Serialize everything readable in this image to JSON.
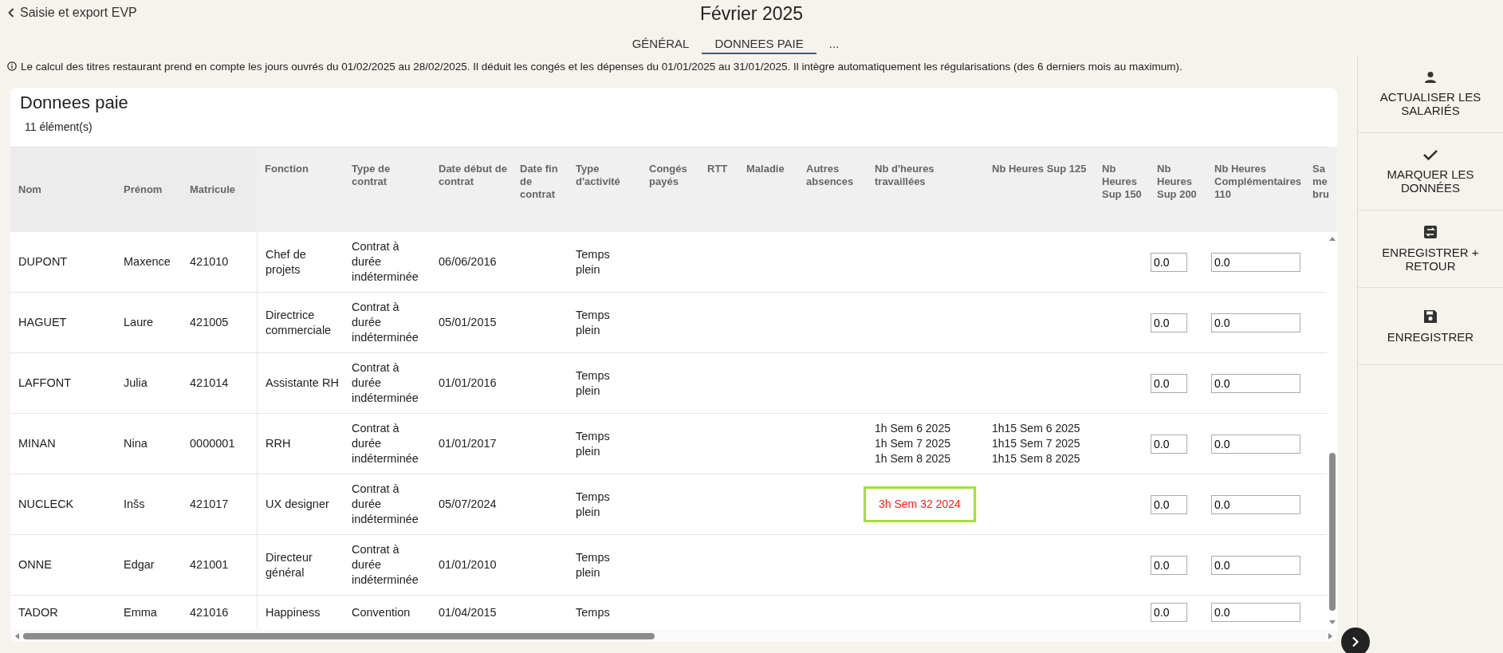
{
  "header": {
    "back_label": "Saisie et export EVP",
    "title": "Février 2025"
  },
  "tabs": [
    {
      "label": "GÉNÉRAL",
      "selected": false
    },
    {
      "label": "DONNEES PAIE",
      "selected": true
    },
    {
      "label": "...",
      "selected": false
    }
  ],
  "info": "Le calcul des titres restaurant prend en compte les jours ouvrés du 01/02/2025 au 28/02/2025. Il déduit les congés et les dépenses du 01/01/2025 au 31/01/2025. Il intègre automatiquement les régularisations (des 6 derniers mois au maximum).",
  "card": {
    "title": "Donnees paie",
    "count": "11 élément(s)"
  },
  "table": {
    "columns": [
      "Nom",
      "Prénom",
      "Matricule",
      "Fonction",
      "Type de contrat",
      "Date début de contrat",
      "Date fin de contrat",
      "Type d'activité",
      "Congés payés",
      "RTT",
      "Maladie",
      "Autres absences",
      "Nb d'heures travaillées",
      "Nb Heures Sup 125",
      "Nb Heures Sup 150",
      "Nb Heures Sup 200",
      "Nb Heures Complémentaires 110",
      "Sa me bru"
    ],
    "rows": [
      {
        "nom": "DUPONT",
        "prenom": "Maxence",
        "matricule": "421010",
        "fonction": "Chef de projets",
        "type_contrat": "Contrat à durée indéterminée",
        "date_debut": "06/06/2016",
        "type_activite": "Temps plein",
        "heures_sup_200": "0.0",
        "heures_compl_110": "0.0"
      },
      {
        "nom": "HAGUET",
        "prenom": "Laure",
        "matricule": "421005",
        "fonction": "Directrice commerciale",
        "type_contrat": "Contrat à durée indéterminée",
        "date_debut": "05/01/2015",
        "type_activite": "Temps plein",
        "heures_sup_200": "0.0",
        "heures_compl_110": "0.0"
      },
      {
        "nom": "LAFFONT",
        "prenom": "Julia",
        "matricule": "421014",
        "fonction": "Assistante RH",
        "type_contrat": "Contrat à durée indéterminée",
        "date_debut": "01/01/2016",
        "type_activite": "Temps plein",
        "heures_sup_200": "0.0",
        "heures_compl_110": "0.0"
      },
      {
        "nom": "MINAN",
        "prenom": "Nina",
        "matricule": "0000001",
        "fonction": "RRH",
        "type_contrat": "Contrat à durée indéterminée",
        "date_debut": "01/01/2017",
        "type_activite": "Temps plein",
        "heures_travaillees": [
          "1h Sem 6 2025",
          "1h Sem 7 2025",
          "1h Sem 8 2025"
        ],
        "heures_sup_125": [
          "1h15 Sem 6 2025",
          "1h15 Sem 7 2025",
          "1h15 Sem 8 2025"
        ],
        "heures_sup_200": "0.0",
        "heures_compl_110": "0.0"
      },
      {
        "nom": "NUCLECK",
        "prenom": "Inšs",
        "matricule": "421017",
        "fonction": "UX designer",
        "type_contrat": "Contrat à durée indéterminée",
        "date_debut": "05/07/2024",
        "type_activite": "Temps plein",
        "heures_travaillees": [
          "3h Sem 32 2024"
        ],
        "heures_sup_200": "0.0",
        "heures_compl_110": "0.0",
        "heures_alert": true
      },
      {
        "nom": "ONNE",
        "prenom": "Edgar",
        "matricule": "421001",
        "fonction": "Directeur général",
        "type_contrat": "Contrat à durée indéterminée",
        "date_debut": "01/01/2010",
        "type_activite": "Temps plein",
        "heures_sup_200": "0.0",
        "heures_compl_110": "0.0"
      },
      {
        "nom": "TADOR",
        "prenom": "Emma",
        "matricule": "421016",
        "fonction": "Happiness",
        "type_contrat": "Convention",
        "date_debut": "01/04/2015",
        "type_activite": "Temps",
        "heures_sup_200": "0.0",
        "heures_compl_110": "0.0"
      }
    ]
  },
  "actions": [
    {
      "kind": "person",
      "label": "ACTUALISER LES SALARIÉS"
    },
    {
      "kind": "check",
      "label": "MARQUER LES DONNÉES"
    },
    {
      "kind": "save-return",
      "label": "ENREGISTRER + RETOUR"
    },
    {
      "kind": "save",
      "label": "ENREGISTRER"
    }
  ]
}
